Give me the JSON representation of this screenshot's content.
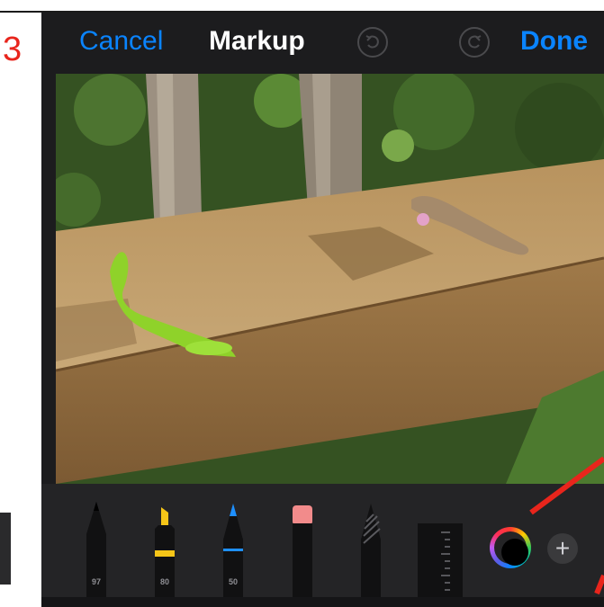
{
  "step": {
    "number": "3"
  },
  "navbar": {
    "cancel_label": "Cancel",
    "title": "Markup",
    "done_label": "Done",
    "undo_icon": "undo-icon",
    "redo_icon": "redo-icon"
  },
  "photo": {
    "subject": "photo-of-lizards-on-wooden-railing"
  },
  "toolbar": {
    "tools": [
      {
        "name": "pen",
        "label": "97"
      },
      {
        "name": "highlighter",
        "label": "80"
      },
      {
        "name": "pencil",
        "label": "50"
      },
      {
        "name": "eraser",
        "label": ""
      },
      {
        "name": "lasso",
        "label": ""
      },
      {
        "name": "ruler",
        "label": ""
      }
    ],
    "selected_color": "#000000",
    "add_icon": "plus-icon",
    "add_label": "+"
  },
  "colors": {
    "accent": "#0a84ff",
    "annotation": "#e8251c",
    "highlighter": "#f5c518",
    "pencil": "#1e90ff",
    "eraser": "#f28b8b"
  }
}
